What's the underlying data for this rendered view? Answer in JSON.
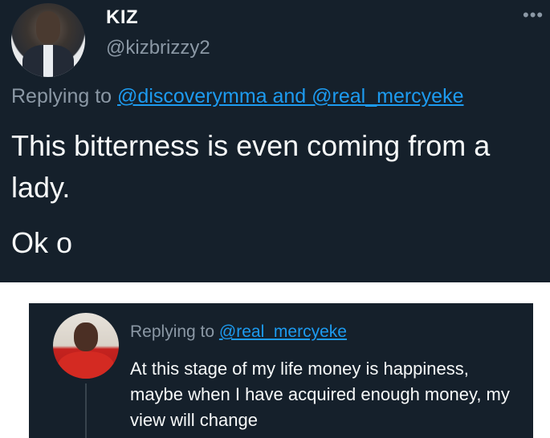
{
  "tweet1": {
    "display_name": "KIZ",
    "handle": "@kizbrizzy2",
    "more_icon": "more-dots-icon",
    "replying_prefix": "Replying to",
    "replying_targets": "@discoverymma and @real_mercyeke",
    "text": "This bitterness is even coming from a lady.",
    "text_line2": "Ok o"
  },
  "tweet2": {
    "replying_prefix": "Replying to",
    "replying_target": "@real_mercyeke",
    "text": "At this stage of my life money is happiness, maybe when I have acquired enough money, my view will change"
  },
  "colors": {
    "background": "#15202b",
    "text": "#f7f9f9",
    "secondary": "#8b98a5",
    "link": "#1d9bf0"
  }
}
